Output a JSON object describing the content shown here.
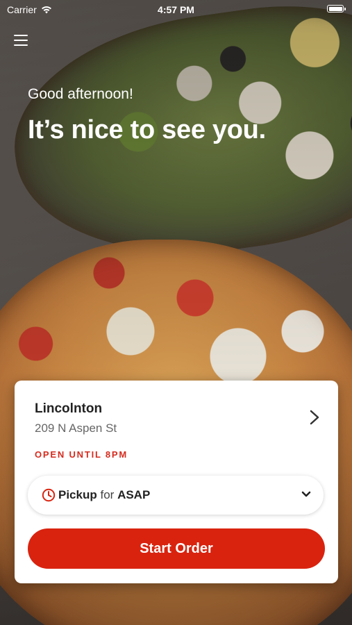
{
  "status_bar": {
    "carrier": "Carrier",
    "time": "4:57 PM"
  },
  "header": {
    "menu_icon": "hamburger-menu-icon",
    "greeting": "Good afternoon!",
    "headline": "It’s nice to see you."
  },
  "location": {
    "name": "Lincolnton",
    "address": "209 N Aspen St",
    "hours": "OPEN UNTIL 8PM"
  },
  "order_type": {
    "icon": "clock-icon",
    "method": "Pickup",
    "connector": "for",
    "time": "ASAP"
  },
  "actions": {
    "start_order_label": "Start Order"
  },
  "colors": {
    "accent": "#d9230f",
    "hours_text": "#d52b1e"
  }
}
